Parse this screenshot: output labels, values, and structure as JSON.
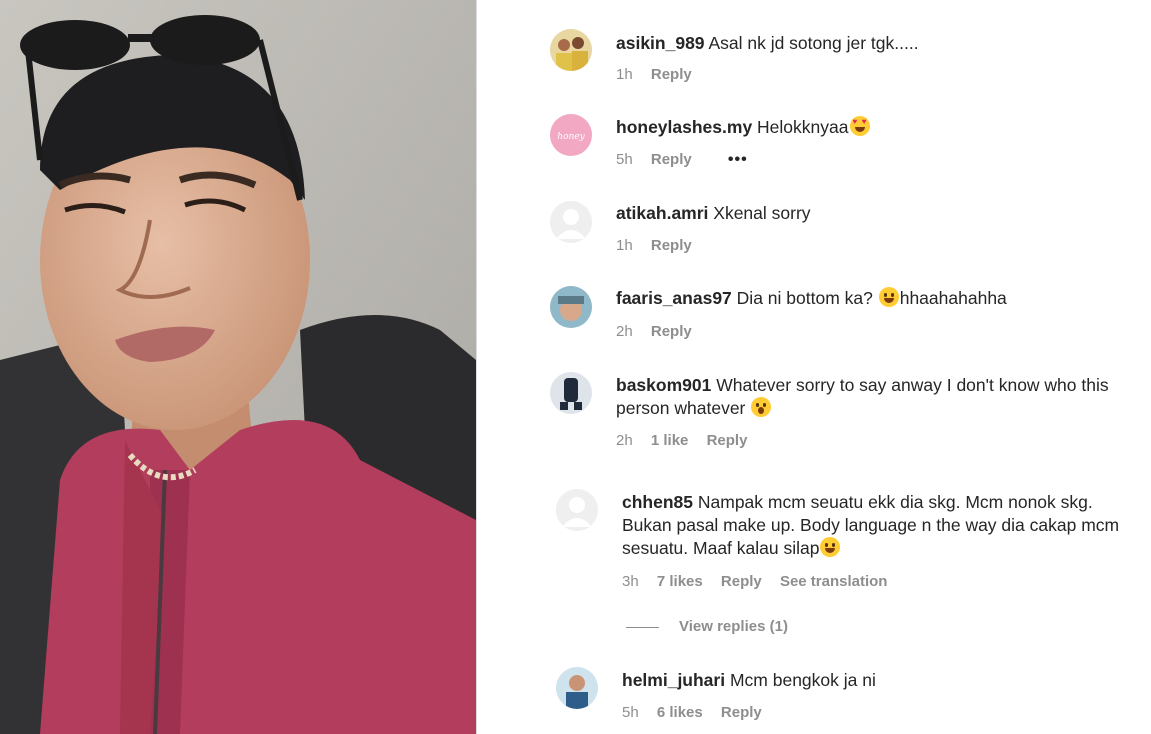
{
  "media": {
    "description_icon": "video-frame"
  },
  "comments": [
    {
      "username": "asikin_989",
      "text": "Asal nk jd sotong jer tgk.....",
      "time": "1h",
      "likes": "",
      "reply": "Reply",
      "avatar": "group-photo-avatar"
    },
    {
      "username": "honeylashes.my",
      "text": "Helokknyaa",
      "emoji": "heart-eyes",
      "time": "5h",
      "likes": "",
      "reply": "Reply",
      "more": "•••",
      "avatar": "pink-brand-avatar"
    },
    {
      "username": "atikah.amri",
      "text": "Xkenal sorry",
      "time": "1h",
      "likes": "",
      "reply": "Reply",
      "avatar": "default-avatar"
    },
    {
      "username": "faaris_anas97",
      "text": "Dia ni bottom ka? ",
      "text_after": "hhaahahahha",
      "emoji": "tears-of-joy",
      "time": "2h",
      "likes": "",
      "reply": "Reply",
      "avatar": "selfie-avatar"
    },
    {
      "username": "baskom901",
      "text": "Whatever sorry to say anway I don't know who this person whatever ",
      "emoji": "astonished",
      "time": "2h",
      "likes": "1 like",
      "reply": "Reply",
      "avatar": "dark-figure-avatar"
    },
    {
      "username": "chhen85",
      "text": "Nampak mcm seuatu ekk dia skg. Mcm nonok skg. Bukan pasal make up. Body language n the way dia cakap mcm sesuatu. Maaf kalau silap",
      "emoji": "tears-of-joy",
      "time": "3h",
      "likes": "7 likes",
      "reply": "Reply",
      "translate": "See translation",
      "view_replies": "View replies (1)",
      "avatar": "default-avatar"
    },
    {
      "username": "helmi_juhari",
      "text": "Mcm bengkok ja ni",
      "time": "5h",
      "likes": "6 likes",
      "reply": "Reply",
      "avatar": "person-photo-avatar"
    }
  ],
  "colors": {
    "text": "#262626",
    "secondary": "#8e8e8e",
    "shirt": "#b33d5c"
  }
}
